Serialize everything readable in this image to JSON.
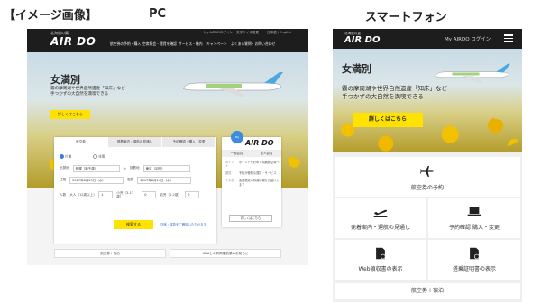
{
  "heading": "【イメージ画像】",
  "pc_label": "PC",
  "sp_label": "スマートフォン",
  "pc": {
    "logo_sub": "北海道の翼",
    "logo": "AIR DO",
    "util_links": [
      "My AIRDOログイン",
      "文字サイズ変更",
      "日本語 / English"
    ],
    "nav": [
      "航空券の予約・購入",
      "空席照会・運賃を確認",
      "サービス・機内",
      "キャンペーン",
      "よくある質問・お問い合わせ"
    ],
    "hero_title": "女満別",
    "hero_sub_1": "霧の摩周湖や世界自然遺産「知床」など",
    "hero_sub_2": "手つかずの大自然を満喫できる",
    "detail_button": "詳しくはこちら",
    "tabs": [
      "航空券",
      "発着案内・運航の見通し",
      "予約確認・購入・変更"
    ],
    "trip_type": [
      "片道",
      "往復"
    ],
    "from_label": "出発地",
    "from_value": "札幌（新千歳）",
    "to_label": "到着地",
    "to_value": "東京（羽田）",
    "depart_label": "往路",
    "depart_value": "2017年8月23日（水）",
    "return_label": "復路",
    "return_value": "2017年8月24日（木）",
    "pax_label": "人数",
    "pax_adult": "大人（12歳以上）",
    "pax_child": "小児（3-11歳）",
    "pax_infant": "幼児（0-2歳）",
    "pax_count": "1",
    "pax_zero": "0",
    "search_button": "検索する",
    "search_link": "空席・運賃をご確認いただけます",
    "side_badge": "My",
    "side_logo": "AIR DO",
    "side_tabs": [
      "一般会員",
      "法人会員"
    ],
    "side_items": [
      {
        "k": "ポイント",
        "v": "ポイントを貯めて特典航空券へ"
      },
      {
        "k": "運賃",
        "v": "予約が便利な運賃・サービス"
      },
      {
        "k": "その他",
        "v": "会員限定の特典情報をお届けします"
      }
    ],
    "side_more": "詳しくはこちら",
    "bottom_links": [
      "航空券＋宿泊",
      "ANAとの共同運航便のお知らせ"
    ]
  },
  "sp": {
    "logo_sub": "北海道の翼",
    "logo": "AIR DO",
    "login": "My AIRDO ログイン",
    "hero_title": "女満別",
    "hero_sub_1": "霧の摩周湖や世界自然遺産「知床」など",
    "hero_sub_2": "手つかずの大自然を満喫できる",
    "detail_button": "詳しくはこちら",
    "menu": {
      "book": "航空券の予約",
      "status": "発着案内・運航の見通し",
      "confirm": "予約確認 購入・変更",
      "receipt": "Web領収書の表示",
      "certificate": "搭乗証明書の表示",
      "package": "航空券＋宿泊"
    }
  },
  "colors": {
    "header": "#1d1d1d",
    "accent": "#ffe200",
    "panel": "#efefef"
  }
}
